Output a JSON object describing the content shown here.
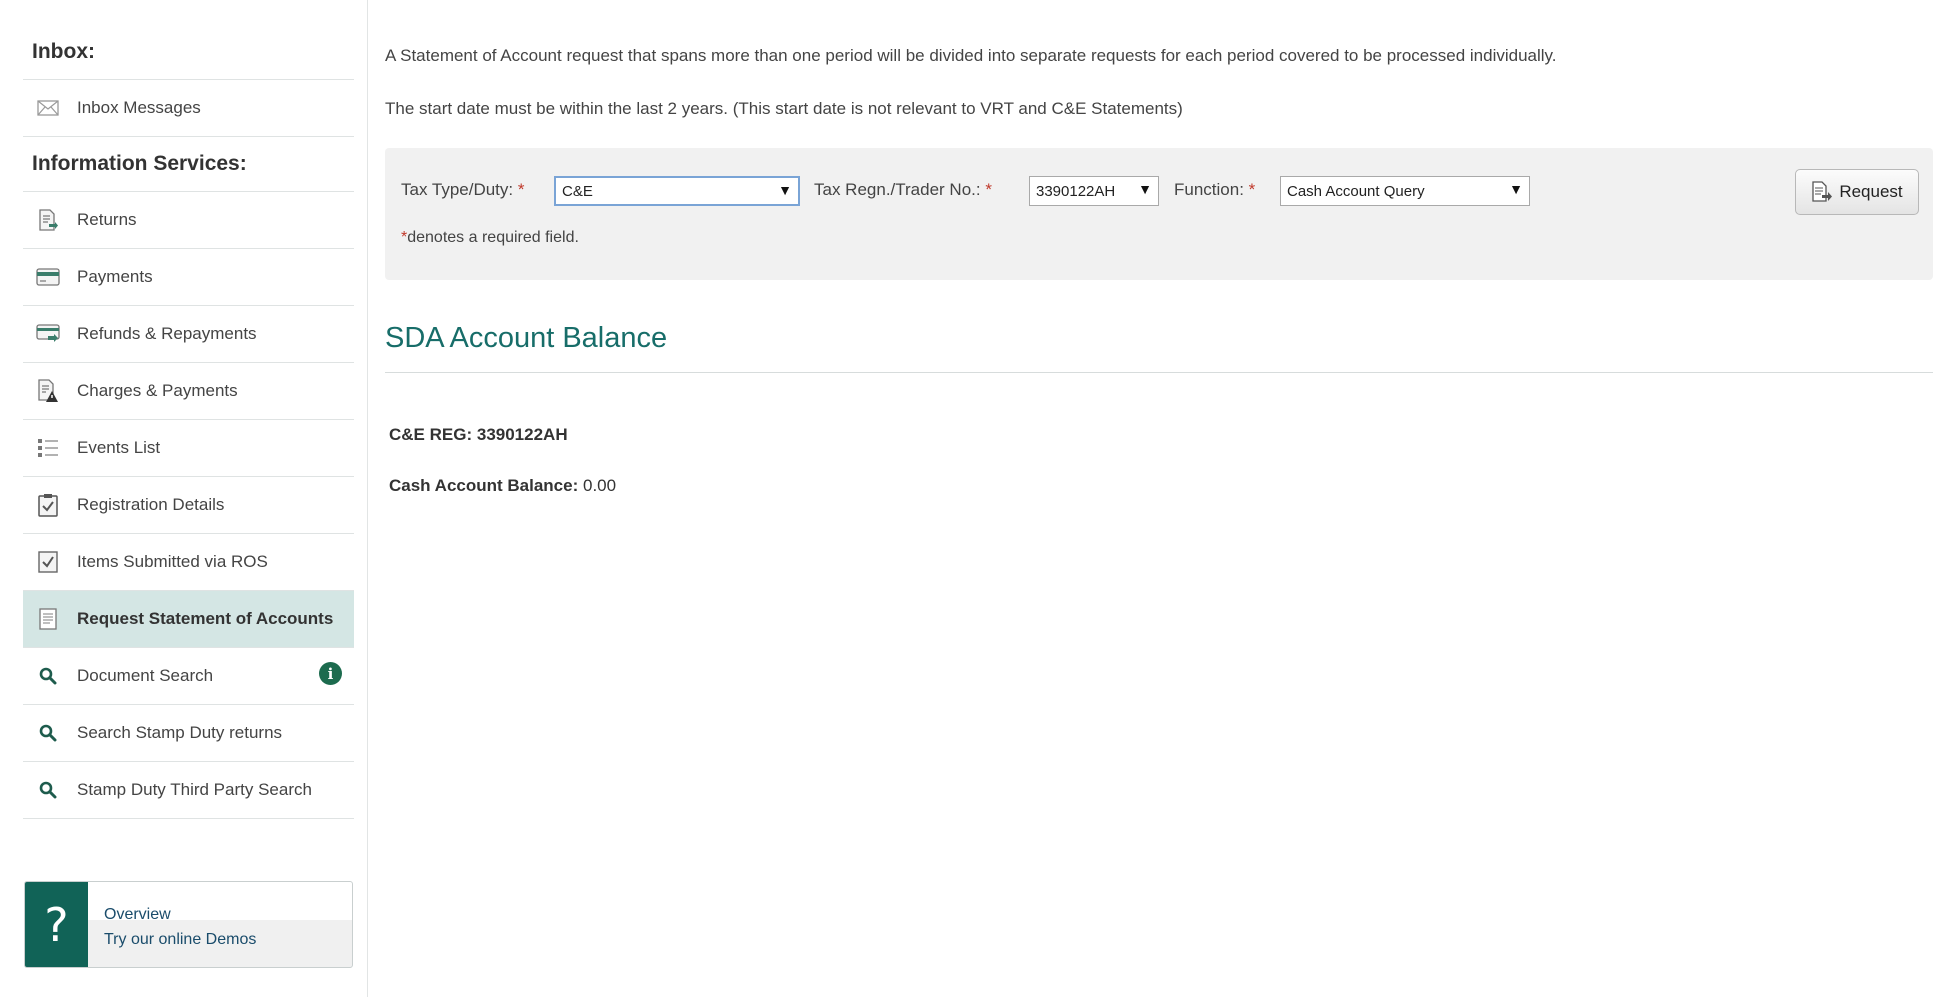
{
  "sidebar": {
    "inbox_heading": "Inbox:",
    "inbox_messages": "Inbox Messages",
    "info_heading": "Information Services:",
    "items": [
      {
        "label": "Returns"
      },
      {
        "label": "Payments"
      },
      {
        "label": "Refunds & Repayments"
      },
      {
        "label": "Charges & Payments"
      },
      {
        "label": "Events List"
      },
      {
        "label": "Registration Details"
      },
      {
        "label": "Items Submitted via ROS"
      },
      {
        "label": "Request Statement of Accounts",
        "active": true
      },
      {
        "label": "Document Search"
      },
      {
        "label": "Search Stamp Duty returns"
      },
      {
        "label": "Stamp Duty Third Party Search"
      }
    ],
    "info_badge": "i",
    "help": {
      "icon_glyph": "?",
      "line1": "Overview",
      "line2": "Try our online Demos"
    }
  },
  "main": {
    "note1": "A Statement of Account request that spans more than one period will be divided into separate requests for each period covered to be processed individually.",
    "note2": "The start date must be within the last 2 years. (This start date is not relevant to VRT and C&E Statements)",
    "form": {
      "tax_type_label": "Tax Type/Duty:",
      "tax_type_value": "C&E",
      "regn_label": "Tax Regn./Trader No.:",
      "regn_value": "3390122AH",
      "function_label": "Function:",
      "function_value": "Cash Account Query",
      "required_marker": "*",
      "required_note": "denotes a required field.",
      "request_button": "Request"
    },
    "section_title": "SDA Account Balance",
    "result": {
      "reg_label": "C&E REG:",
      "reg_value": "3390122AH",
      "balance_label": "Cash Account Balance:",
      "balance_value": "0.00"
    }
  },
  "colors": {
    "accent_teal": "#176d69",
    "active_bg": "#d4e6e4",
    "help_dark": "#116357",
    "required_red": "#c0392b",
    "info_green": "#1c6b4e"
  }
}
